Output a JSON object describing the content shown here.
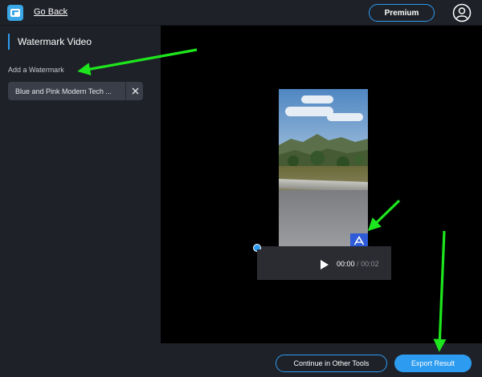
{
  "header": {
    "go_back_label": "Go Back",
    "premium_label": "Premium"
  },
  "sidebar": {
    "title": "Watermark Video",
    "section_label": "Add a Watermark",
    "watermark_name": "Blue and Pink Modern Tech ..."
  },
  "player": {
    "current_time": "00:00",
    "separator": "/",
    "duration": "00:02",
    "progress": 0
  },
  "footer": {
    "continue_label": "Continue in Other Tools",
    "export_label": "Export Result"
  },
  "colors": {
    "accent": "#2d9cf0",
    "background": "#1e2128",
    "preview": "#000000",
    "annotation_arrow": "#1ee61e"
  },
  "icons": {
    "app": "app-logo-icon",
    "user": "user-circle-icon",
    "close": "close-icon",
    "play": "play-icon",
    "watermark": "watermark-a-icon"
  }
}
